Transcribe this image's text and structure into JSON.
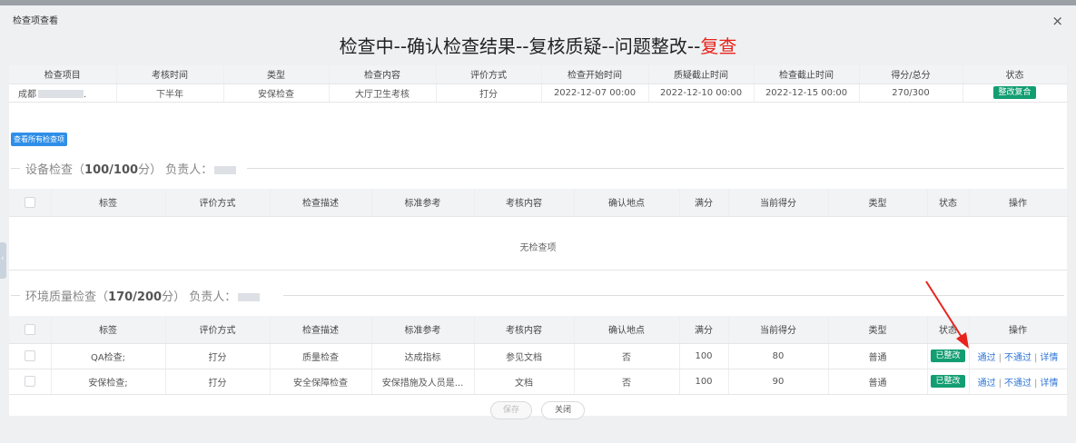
{
  "modal": {
    "title": "检查项查看",
    "close_glyph": "×",
    "headline_prefix": "检查中--确认检查结果--复核质疑--问题整改--",
    "headline_current": "复查"
  },
  "info_table": {
    "columns": [
      "检查项目",
      "考核时间",
      "类型",
      "检查内容",
      "评价方式",
      "检查开始时间",
      "质疑截止时间",
      "检查截止时间",
      "得分/总分",
      "状态"
    ],
    "row": {
      "project": "成都",
      "project_suffix": ".",
      "period": "下半年",
      "type": "安保检查",
      "content": "大厅卫生考核",
      "method": "打分",
      "start": "2022-12-07 00:00",
      "question_deadline": "2022-12-10 00:00",
      "check_deadline": "2022-12-15 00:00",
      "score": "270/300",
      "status": "整改复合"
    }
  },
  "view_all_button": "查看所有检查项",
  "section1": {
    "name": "设备检查",
    "score": "100/100",
    "open": "（",
    "unit_close": "分）",
    "owner_label": "负责人："
  },
  "section2": {
    "name": "环境质量检查",
    "score": "170/200",
    "open": "（",
    "unit_close": "分）",
    "owner_label": "负责人："
  },
  "item_columns": [
    "标签",
    "评价方式",
    "检查描述",
    "标准参考",
    "考核内容",
    "确认地点",
    "满分",
    "当前得分",
    "类型",
    "状态",
    "操作"
  ],
  "section1_empty": "无检查项",
  "section2_rows": [
    {
      "tag": "QA检查;",
      "method": "打分",
      "desc": "质量检查",
      "standard": "达成指标",
      "content": "参见文档",
      "location": "否",
      "full": "100",
      "score": "80",
      "type": "普通",
      "status": "已整改",
      "pass": "通过",
      "fail": "不通过",
      "detail": "详情"
    },
    {
      "tag": "安保检查;",
      "method": "打分",
      "desc": "安全保障检查",
      "standard": "安保措施及人员是...",
      "content": "文档",
      "location": "否",
      "full": "100",
      "score": "90",
      "type": "普通",
      "status": "已整改",
      "pass": "通过",
      "fail": "不通过",
      "detail": "详情"
    }
  ],
  "action_separator": "|",
  "footer": {
    "save": "保存",
    "close": "关闭"
  },
  "side_tab_glyph": "‹",
  "colors": {
    "headline_red": "#e8231b",
    "badge_green": "#139e72",
    "link_blue": "#2f76d6",
    "button_blue": "#2f8fe8",
    "arrow_red": "#e8231b"
  }
}
